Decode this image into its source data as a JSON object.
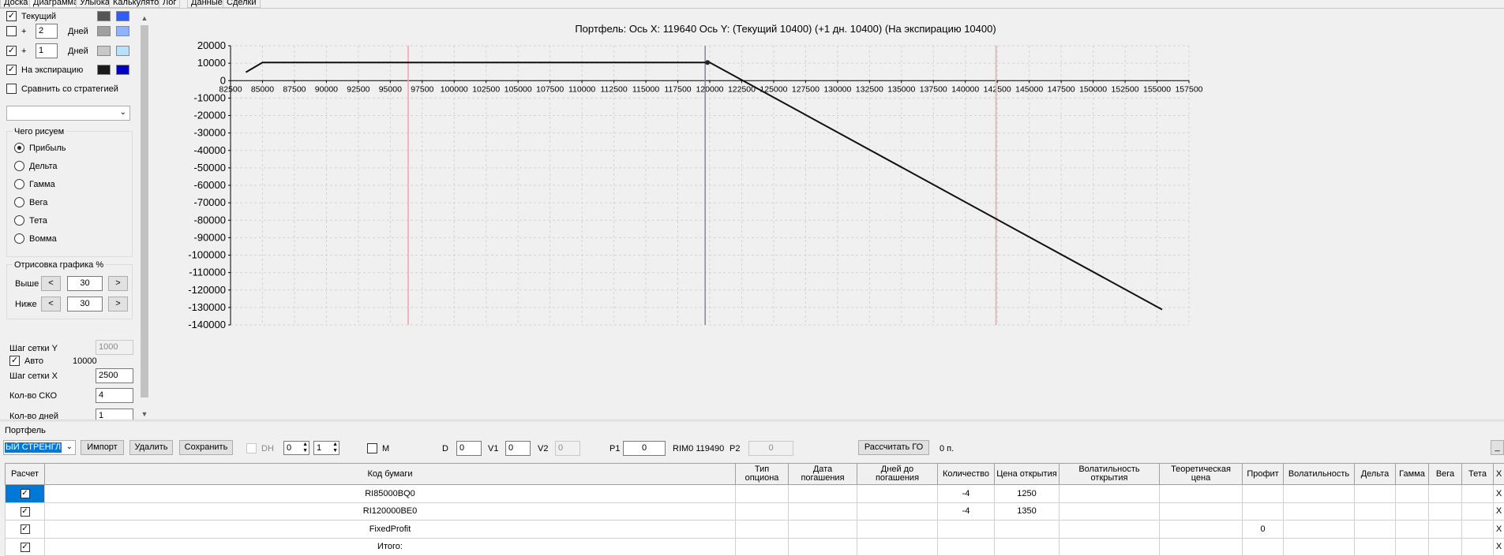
{
  "tabs": [
    {
      "label": "Доска"
    },
    {
      "label": "Диаграмма"
    },
    {
      "label": "Улыбка"
    },
    {
      "label": "Калькулятор"
    },
    {
      "label": "Лог"
    },
    {
      "label": "Данные"
    },
    {
      "label": "Сделки"
    }
  ],
  "left": {
    "current_label": "Текущий",
    "plus_sign": "+",
    "days_label": "Дней",
    "plus_days_1": "2",
    "plus_days_2": "1",
    "expiry_label": "На экспирацию",
    "compare_label": "Сравнить со стратегией",
    "what_group": "Чего рисуем",
    "radios": [
      {
        "label": "Прибыль"
      },
      {
        "label": "Дельта"
      },
      {
        "label": "Гамма"
      },
      {
        "label": "Вега"
      },
      {
        "label": "Тета"
      },
      {
        "label": "Вомма"
      }
    ],
    "draw_group": "Отрисовка графика %",
    "above_label": "Выше",
    "below_label": "Ниже",
    "above_value": "30",
    "below_value": "30",
    "btn_less": "<",
    "btn_more": ">",
    "grid_y_label": "Шаг сетки Y",
    "grid_y_value": "1000",
    "auto_label": "Авто",
    "auto_value": "10000",
    "grid_x_label": "Шаг сетки X",
    "grid_x_value": "2500",
    "sko_label": "Кол-во СКО",
    "sko_value": "4",
    "days_count_label": "Кол-во дней",
    "days_count_value": "1",
    "colors": {
      "current_dark": "#555555",
      "current_light": "#2f5bff",
      "p2_dark": "#a0a0a0",
      "p2_light": "#8fb3ff",
      "p1_dark": "#c8c8c8",
      "p1_light": "#b8e0ff",
      "exp_dark": "#1a1a1a",
      "exp_light": "#0000c0"
    }
  },
  "chart_title": "Портфель: Ось X: 119640 Ось Y:  (Текущий 10400)  (+1 дн. 10400)  (На экспирацию 10400)",
  "chart_data": {
    "type": "line",
    "title": "Портфель: Ось X: 119640 Ось Y:  (Текущий 10400)  (+1 дн. 10400)  (На экспирацию 10400)",
    "xlim": [
      82500,
      157500
    ],
    "ylim": [
      -140000,
      20000
    ],
    "x_ticks": [
      82500,
      85000,
      87500,
      90000,
      92500,
      95000,
      97500,
      100000,
      102500,
      105000,
      107500,
      110000,
      112500,
      115000,
      117500,
      120000,
      122500,
      125000,
      127500,
      130000,
      132500,
      135000,
      137500,
      140000,
      142500,
      145000,
      147500,
      150000,
      152500,
      155000,
      157500
    ],
    "y_ticks": [
      20000,
      10000,
      0,
      -10000,
      -20000,
      -30000,
      -40000,
      -50000,
      -60000,
      -70000,
      -80000,
      -90000,
      -100000,
      -110000,
      -120000,
      -130000,
      -140000
    ],
    "grid": true,
    "series": [
      {
        "x": [
          83700,
          85000,
          120000,
          155400
        ],
        "y": [
          4800,
          10400,
          10400,
          -131200
        ]
      }
    ],
    "vlines": [
      {
        "x": 96400,
        "color": "#f2a0b0"
      },
      {
        "x": 119640,
        "color": "#7a8aa0"
      },
      {
        "x": 142400,
        "color": "#f2a0b0"
      }
    ],
    "marker": {
      "x": 119640,
      "y": 10400
    }
  },
  "portfolio": {
    "label": "Портфель",
    "strategy_value": "ЫЙ СТРЕНГЛ",
    "import_btn": "Импорт",
    "delete_btn": "Удалить",
    "save_btn": "Сохранить",
    "dh_label": "DH",
    "dh_val1": "0",
    "dh_val2": "1",
    "m_label": "M",
    "d_label": "D",
    "d_value": "0",
    "v1_label": "V1",
    "v1_value": "0",
    "v2_label": "V2",
    "v2_value": "0",
    "p1_label": "P1",
    "p1_value": "0",
    "rim_text": "RIM0 119490",
    "p2_label": "P2",
    "p2_value": "0",
    "calc_btn": "Рассчитать ГО",
    "go_value": "0 п.",
    "min_btn": "_",
    "headers": [
      "Расчет",
      "Код бумаги",
      "Тип опциона",
      "Дата погашения",
      "Дней до погашения",
      "Количество",
      "Цена открытия",
      "Волатильность открытия",
      "Теоретическая цена",
      "Профит",
      "Волатильность",
      "Дельта",
      "Гамма",
      "Вега",
      "Тета",
      "X"
    ],
    "rows": [
      {
        "code": "RI85000BQ0",
        "qty": "-4",
        "price": "1250",
        "profit": ""
      },
      {
        "code": "RI120000BE0",
        "qty": "-4",
        "price": "1350",
        "profit": ""
      },
      {
        "code": "FixedProfit",
        "qty": "",
        "price": "",
        "profit": "0"
      },
      {
        "code": "Итого:",
        "qty": "",
        "price": "",
        "profit": ""
      }
    ]
  }
}
